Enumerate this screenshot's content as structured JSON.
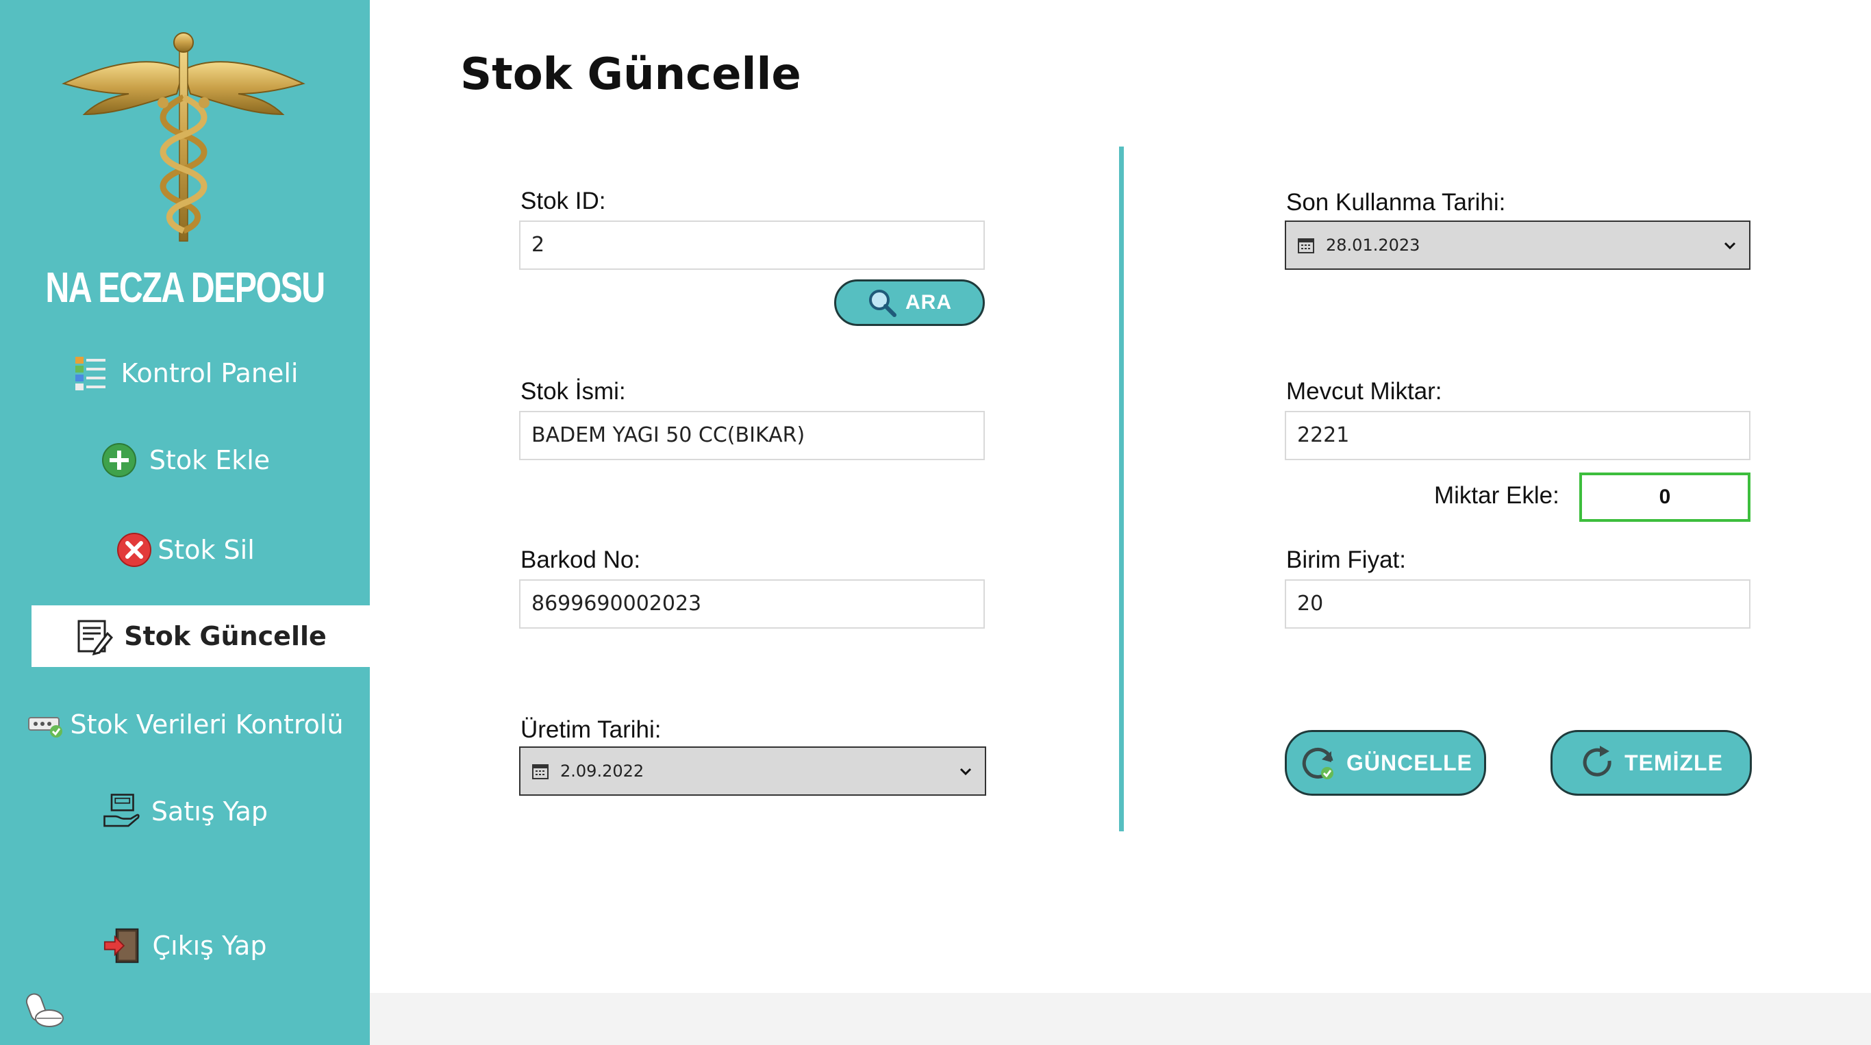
{
  "app": {
    "brand": "NA ECZA DEPOSU"
  },
  "sidebar": {
    "items": [
      {
        "label": "Kontrol Paneli",
        "icon": "dashboard-icon"
      },
      {
        "label": "Stok Ekle",
        "icon": "plus-circle-icon"
      },
      {
        "label": "Stok Sil",
        "icon": "x-circle-icon"
      },
      {
        "label": "Stok Güncelle",
        "icon": "edit-document-icon",
        "active": true
      },
      {
        "label": "Stok Verileri Kontrolü",
        "icon": "data-check-icon"
      },
      {
        "label": "Satış Yap",
        "icon": "register-hand-icon"
      },
      {
        "label": "Çıkış Yap",
        "icon": "exit-door-icon"
      }
    ]
  },
  "page": {
    "title": "Stok Güncelle"
  },
  "form": {
    "stok_id": {
      "label": "Stok ID:",
      "value": "2"
    },
    "search_button": {
      "label": "ARA",
      "icon": "magnifier-icon"
    },
    "stok_ismi": {
      "label": "Stok İsmi:",
      "value": "BADEM YAGI 50 CC(BIKAR)"
    },
    "barkod_no": {
      "label": "Barkod No:",
      "value": "8699690002023"
    },
    "uretim_tarihi": {
      "label": "Üretim Tarihi:",
      "value": "2.09.2022"
    },
    "son_kullanma": {
      "label": "Son Kullanma Tarihi:",
      "value": "28.01.2023"
    },
    "mevcut_miktar": {
      "label": "Mevcut Miktar:",
      "value": "2221"
    },
    "miktar_ekle": {
      "label": "Miktar Ekle:",
      "value": "0"
    },
    "birim_fiyat": {
      "label": "Birim Fiyat:",
      "value": "20"
    },
    "update_button": {
      "label": "GÜNCELLE",
      "icon": "refresh-check-icon"
    },
    "clear_button": {
      "label": "TEMİZLE",
      "icon": "refresh-icon"
    }
  },
  "colors": {
    "accent": "#56BFC1",
    "active_border": "#3DBE3D",
    "date_picker_bg": "#D9D9D9"
  }
}
